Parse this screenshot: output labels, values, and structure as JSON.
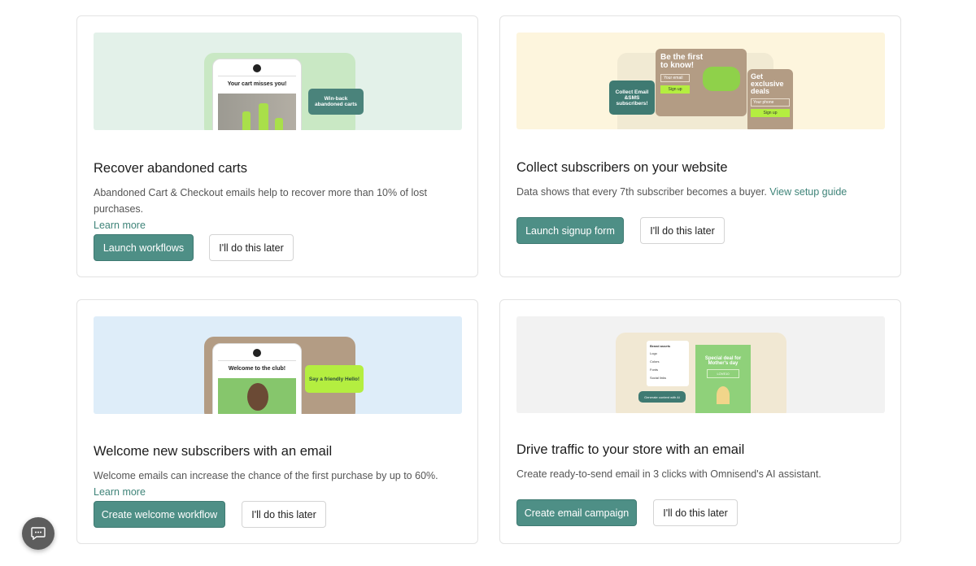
{
  "cards": [
    {
      "title": "Recover abandoned carts",
      "description": "Abandoned Cart & Checkout emails help to recover more than 10% of lost purchases.",
      "link": "Learn more",
      "primary": "Launch workflows",
      "secondary": "I'll do this later",
      "illustration": {
        "phone_heading": "Your cart misses you!",
        "tag": "Win-back abandoned carts"
      }
    },
    {
      "title": "Collect subscribers on your website",
      "description": "Data shows that every 7th subscriber becomes a buyer.",
      "link": "View setup guide",
      "primary": "Launch signup form",
      "secondary": "I'll do this later",
      "illustration": {
        "tag": "Collect Email &SMS subscribers!",
        "form1_heading": "Be the first to know!",
        "form1_input": "Your email",
        "form1_button": "Sign up",
        "form2_heading": "Get exclusive deals",
        "form2_input": "Your phone",
        "form2_button": "Sign up"
      }
    },
    {
      "title": "Welcome new subscribers with an email",
      "description": "Welcome emails can increase the chance of the first purchase by up to 60%.",
      "link": "Learn more",
      "primary": "Create welcome workflow",
      "secondary": "I'll do this later",
      "illustration": {
        "phone_heading": "Welcome to the club!",
        "tag": "Say a friendly Hello!"
      }
    },
    {
      "title": "Drive traffic to your store with an email",
      "description": "Create ready-to-send email in 3 clicks with Omnisend's AI assistant.",
      "primary": "Create email campaign",
      "secondary": "I'll do this later",
      "illustration": {
        "panel_heading": "Brand assets",
        "rows": [
          "Logo",
          "Colors",
          "Fonts",
          "Social links"
        ],
        "email_heading": "Special deal for Mother's day",
        "code": "LOVE10",
        "tag": "Generate content with AI"
      }
    }
  ],
  "colors": {
    "accent": "#4e8f86",
    "link": "#3f8479"
  }
}
